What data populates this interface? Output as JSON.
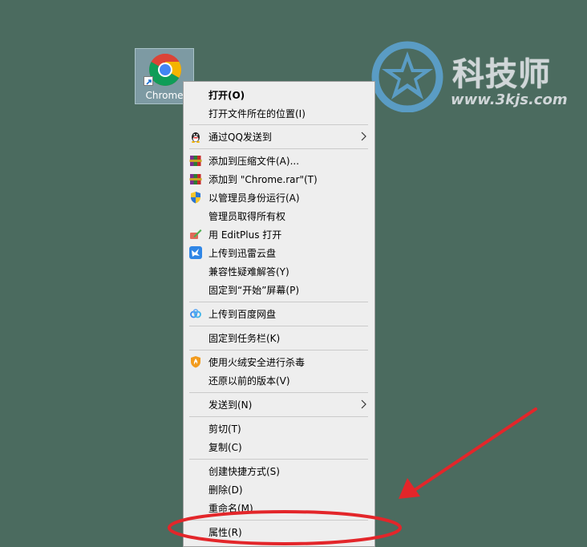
{
  "desktop": {
    "icon_label": "Chrome"
  },
  "watermark": {
    "title": "科技师",
    "url": "www.3kjs.com"
  },
  "menu": {
    "open": "打开(O)",
    "open_location": "打开文件所在的位置(I)",
    "send_qq": "通过QQ发送到",
    "add_archive": "添加到压缩文件(A)...",
    "add_rar": "添加到 \"Chrome.rar\"(T)",
    "run_as_admin": "以管理员身份运行(A)",
    "take_ownership": "管理员取得所有权",
    "editplus": "用 EditPlus 打开",
    "upload_xunlei": "上传到迅雷云盘",
    "compat": "兼容性疑难解答(Y)",
    "pin_start": "固定到“开始”屏幕(P)",
    "upload_baidu": "上传到百度网盘",
    "pin_taskbar": "固定到任务栏(K)",
    "huorong": "使用火绒安全进行杀毒",
    "restore": "还原以前的版本(V)",
    "send_to": "发送到(N)",
    "cut": "剪切(T)",
    "copy": "复制(C)",
    "create_shortcut": "创建快捷方式(S)",
    "delete": "删除(D)",
    "rename": "重命名(M)",
    "properties": "属性(R)"
  },
  "icons": {
    "chrome": "chrome-icon",
    "qq": "qq-penguin-icon",
    "winrar": "winrar-books-icon",
    "uac": "uac-shield-icon",
    "editplus": "editplus-icon",
    "xunlei": "xunlei-bird-icon",
    "baidu": "baidu-cloud-icon",
    "huorong": "huorong-shield-icon",
    "submenu": "chevron-right-icon"
  },
  "colors": {
    "desktop_bg": "#4b6b5f",
    "menu_bg": "#eeeeee",
    "annotation": "#e3262a"
  }
}
